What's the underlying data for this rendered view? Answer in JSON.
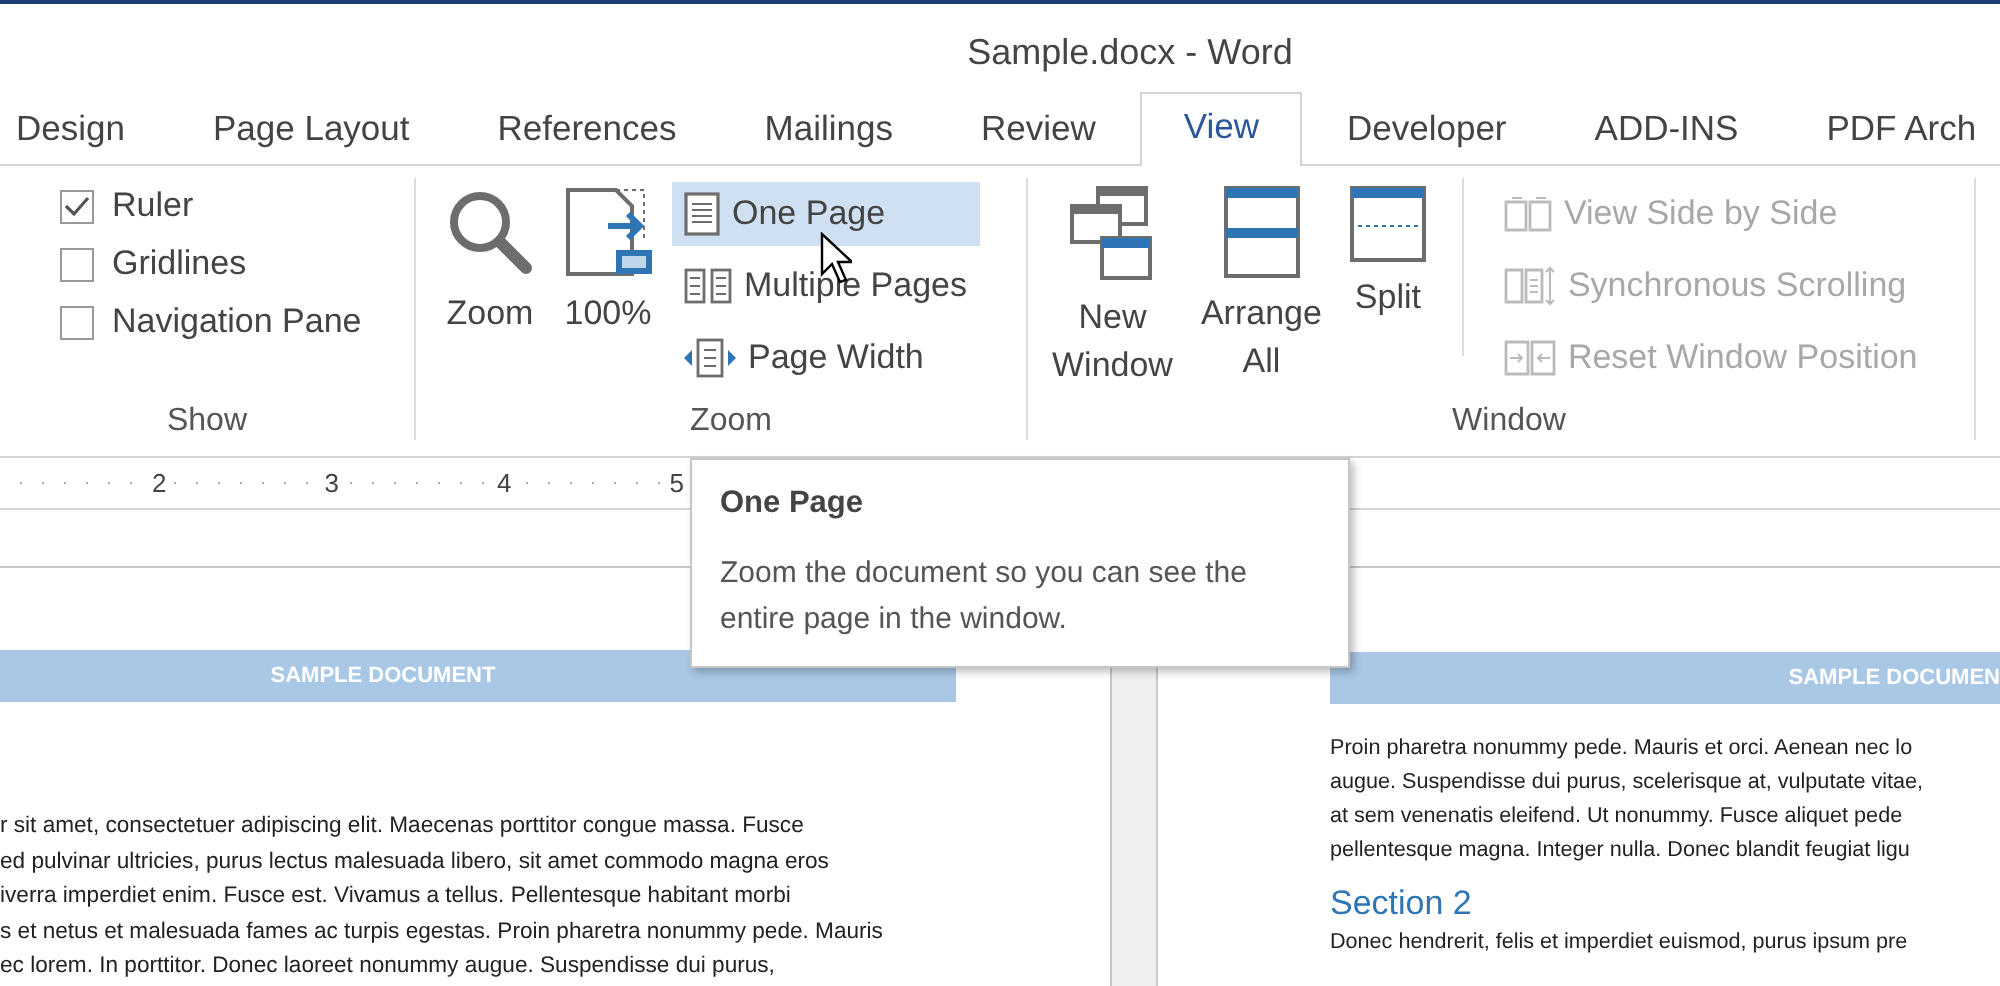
{
  "window": {
    "title": "Sample.docx - Word"
  },
  "tabs": [
    {
      "label": "Design",
      "selected": false
    },
    {
      "label": "Page Layout",
      "selected": false
    },
    {
      "label": "References",
      "selected": false
    },
    {
      "label": "Mailings",
      "selected": false
    },
    {
      "label": "Review",
      "selected": false
    },
    {
      "label": "View",
      "selected": true
    },
    {
      "label": "Developer",
      "selected": false
    },
    {
      "label": "ADD-INS",
      "selected": false
    },
    {
      "label": "PDF Arch",
      "selected": false
    }
  ],
  "ribbon": {
    "show": {
      "label": "Show",
      "checkboxes": [
        {
          "label": "Ruler",
          "checked": true
        },
        {
          "label": "Gridlines",
          "checked": false
        },
        {
          "label": "Navigation Pane",
          "checked": false
        }
      ]
    },
    "zoom": {
      "label": "Zoom",
      "large_buttons": [
        {
          "label": "Zoom",
          "kind": "magnifier"
        },
        {
          "label": "100%",
          "kind": "hundred"
        }
      ],
      "small_buttons": [
        {
          "label": "One Page",
          "kind": "one-page",
          "selected": true
        },
        {
          "label": "Multiple Pages",
          "kind": "multiple-pages",
          "selected": false
        },
        {
          "label": "Page Width",
          "kind": "page-width",
          "selected": false
        }
      ]
    },
    "window": {
      "label": "Window",
      "large_buttons": [
        {
          "label": "New Window",
          "kind": "new-window"
        },
        {
          "label": "Arrange All",
          "kind": "arrange-all"
        },
        {
          "label": "Split",
          "kind": "split"
        }
      ],
      "small_buttons": [
        {
          "label": "View Side by Side",
          "kind": "side-by-side",
          "disabled": true
        },
        {
          "label": "Synchronous Scrolling",
          "kind": "sync-scroll",
          "disabled": true
        },
        {
          "label": "Reset Window Position",
          "kind": "reset-position",
          "disabled": true
        }
      ]
    }
  },
  "ruler": {
    "numbers": [
      "2",
      "3",
      "4",
      "5"
    ]
  },
  "tooltip": {
    "title": "One Page",
    "text": "Zoom the document so you can see the entire page in the window."
  },
  "left_page": {
    "header": "SAMPLE DOCUMENT",
    "lines": [
      "r sit amet, consectetuer adipiscing elit. Maecenas porttitor congue massa. Fusce",
      "ed pulvinar ultricies, purus lectus malesuada libero, sit amet commodo magna eros",
      "iverra imperdiet enim. Fusce est. Vivamus a tellus. Pellentesque habitant morbi",
      "s et netus et malesuada fames ac turpis egestas. Proin pharetra nonummy pede. Mauris",
      "ec lorem. In porttitor. Donec laoreet nonummy augue. Suspendisse dui purus,"
    ]
  },
  "right_page": {
    "header": "SAMPLE DOCUMEN",
    "lines": [
      "Proin pharetra nonummy pede. Mauris et orci. Aenean nec lo",
      "augue. Suspendisse dui purus, scelerisque at, vulputate vitae,",
      "at sem venenatis eleifend. Ut nonummy. Fusce aliquet pede",
      "pellentesque magna. Integer nulla. Donec blandit feugiat ligu"
    ],
    "heading": "Section 2",
    "after_lines": [
      "Donec hendrerit, felis et imperdiet euismod, purus ipsum pre"
    ]
  }
}
